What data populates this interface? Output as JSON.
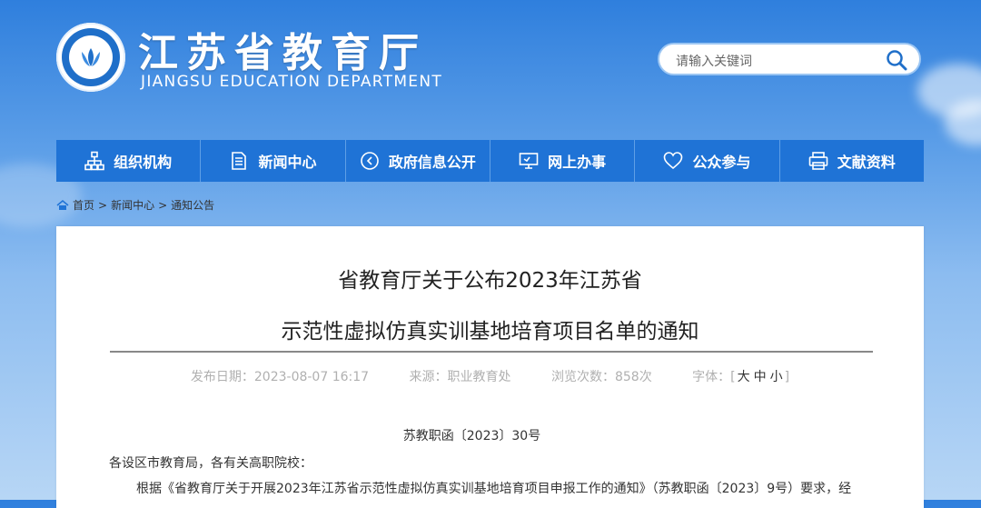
{
  "header": {
    "title": "江苏省教育厅",
    "subtitle": "JIANGSU EDUCATION DEPARTMENT"
  },
  "search": {
    "placeholder": "请输入关键词"
  },
  "nav": [
    {
      "label": "组织机构",
      "icon": "org-chart-icon"
    },
    {
      "label": "新闻中心",
      "icon": "document-icon"
    },
    {
      "label": "政府信息公开",
      "icon": "circle-arrow-icon"
    },
    {
      "label": "网上办事",
      "icon": "monitor-icon"
    },
    {
      "label": "公众参与",
      "icon": "heart-icon"
    },
    {
      "label": "文献资料",
      "icon": "printer-icon"
    }
  ],
  "breadcrumb": {
    "home": "首页",
    "section": "新闻中心",
    "current": "通知公告",
    "sep": ">"
  },
  "article": {
    "title_line1": "省教育厅关于公布2023年江苏省",
    "title_line2": "示范性虚拟仿真实训基地培育项目名单的通知",
    "meta": {
      "date": "发布日期：2023-08-07 16:17",
      "source": "来源：职业教育处",
      "views": "浏览次数：858次",
      "font_label": "字体：",
      "font_large": "大",
      "font_medium": "中",
      "font_small": "小"
    },
    "doc_no": "苏教职函〔2023〕30号",
    "salutation": "各设区市教育局，各有关高职院校：",
    "paragraph": "根据《省教育厅关于开展2023年江苏省示范性虚拟仿真实训基地培育项目申报工作的通知》（苏教职函〔2023〕9号）要求，经"
  },
  "colors": {
    "nav_bg": "#1f73d6",
    "sky_top": "#2f7fdd"
  }
}
